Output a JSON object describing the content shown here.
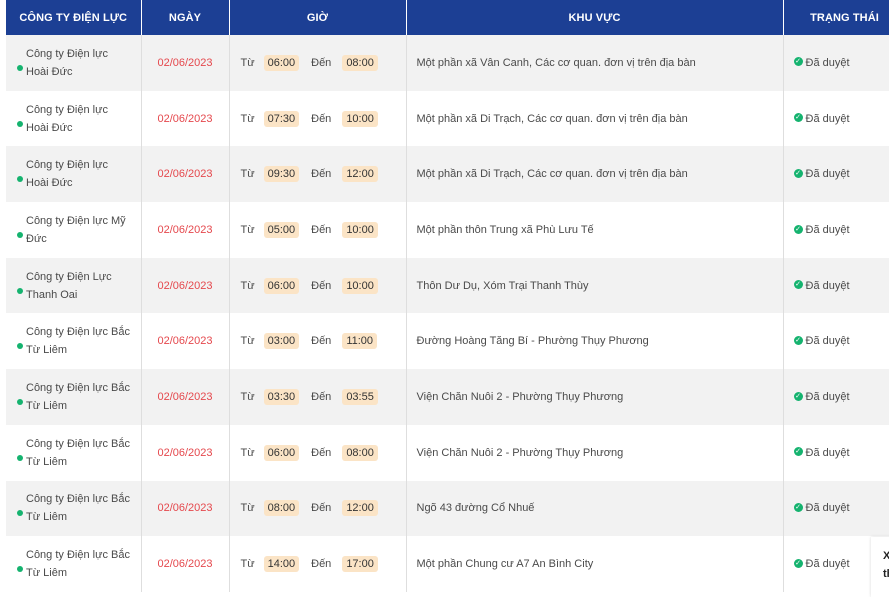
{
  "table": {
    "headers": [
      "CÔNG TY ĐIỆN LỰC",
      "NGÀY",
      "GIỜ",
      "KHU VỰC",
      "TRẠNG THÁI"
    ],
    "from_label": "Từ",
    "to_label": "Đến",
    "rows": [
      {
        "unit_line1": "Công ty Điện lực",
        "unit_line2": "Hoài Đức",
        "date": "02/06/2023",
        "start": "06:00",
        "end": "08:00",
        "area": "Một phần xã Vân Canh, Các cơ quan. đơn vị trên địa bàn",
        "status": "Đã duyệt"
      },
      {
        "unit_line1": "Công ty Điện lực",
        "unit_line2": "Hoài Đức",
        "date": "02/06/2023",
        "start": "07:30",
        "end": "10:00",
        "area": "Một phần xã Di Trạch, Các cơ quan. đơn vị trên địa bàn",
        "status": "Đã duyệt"
      },
      {
        "unit_line1": "Công ty Điện lực",
        "unit_line2": "Hoài Đức",
        "date": "02/06/2023",
        "start": "09:30",
        "end": "12:00",
        "area": "Một phần xã Di Trạch, Các cơ quan. đơn vị trên địa bàn",
        "status": "Đã duyệt"
      },
      {
        "unit_line1": "Công ty Điện lực Mỹ",
        "unit_line2": "Đức",
        "date": "02/06/2023",
        "start": "05:00",
        "end": "10:00",
        "area": "Một phần thôn Trung xã Phù Lưu Tế",
        "status": "Đã duyệt"
      },
      {
        "unit_line1": "Công ty Điện Lực",
        "unit_line2": "Thanh Oai",
        "date": "02/06/2023",
        "start": "06:00",
        "end": "10:00",
        "area": "Thôn Dư Dụ, Xóm Trại Thanh Thùy",
        "status": "Đã duyệt"
      },
      {
        "unit_line1": "Công ty Điện lực Bắc",
        "unit_line2": "Từ Liêm",
        "date": "02/06/2023",
        "start": "03:00",
        "end": "11:00",
        "area": "Đường Hoàng Tăng Bí - Phường Thụy Phương",
        "status": "Đã duyệt"
      },
      {
        "unit_line1": "Công ty Điện lực Bắc",
        "unit_line2": "Từ Liêm",
        "date": "02/06/2023",
        "start": "03:30",
        "end": "03:55",
        "area": "Viện Chăn Nuôi 2 - Phường Thụy Phương",
        "status": "Đã duyệt"
      },
      {
        "unit_line1": "Công ty Điện lực Bắc",
        "unit_line2": "Từ Liêm",
        "date": "02/06/2023",
        "start": "06:00",
        "end": "08:00",
        "area": "Viện Chăn Nuôi 2 - Phường Thụy Phương",
        "status": "Đã duyệt"
      },
      {
        "unit_line1": "Công ty Điện lực Bắc",
        "unit_line2": "Từ Liêm",
        "date": "02/06/2023",
        "start": "08:00",
        "end": "12:00",
        "area": "Ngõ 43 đường Cổ Nhuế",
        "status": "Đã duyệt"
      },
      {
        "unit_line1": "Công ty Điện lực Bắc",
        "unit_line2": "Từ Liêm",
        "date": "02/06/2023",
        "start": "14:00",
        "end": "17:00",
        "area": "Một phần Chung cư A7 An Bình City",
        "status": "Đã duyệt"
      }
    ]
  },
  "side_popup": {
    "line1": "X",
    "line2": "th"
  },
  "colors": {
    "header_bg": "#1c3f94",
    "dot": "#15b36f",
    "date": "#e5484d",
    "chip_bg": "#fbe4c6"
  }
}
